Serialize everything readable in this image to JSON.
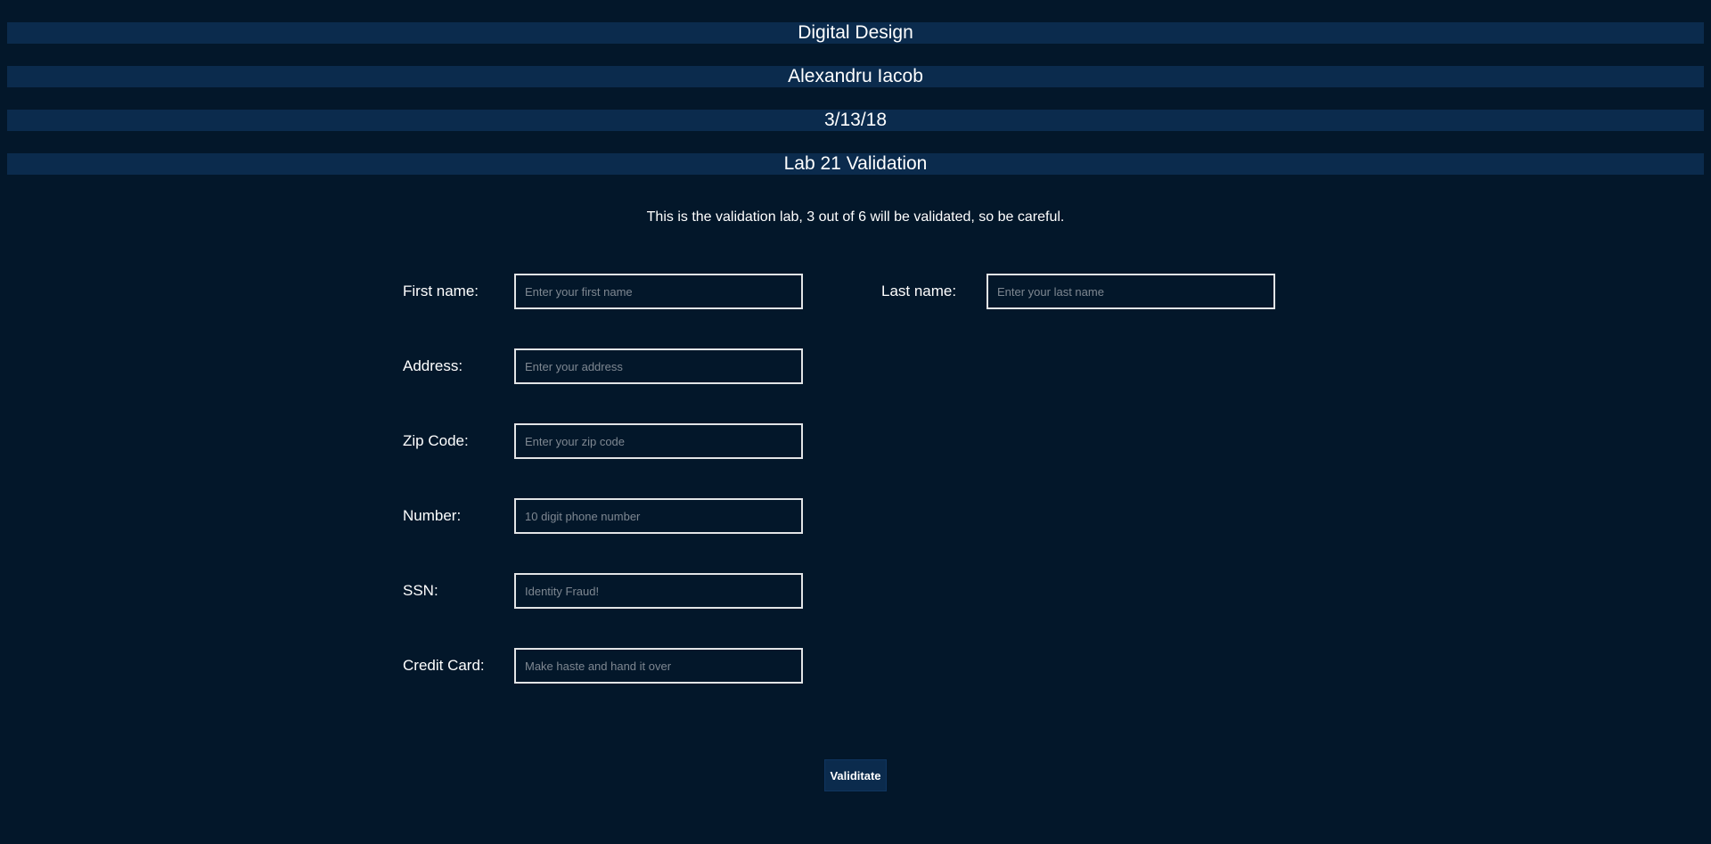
{
  "header": {
    "course": "Digital Design",
    "author": "Alexandru Iacob",
    "date": "3/13/18",
    "title": "Lab 21 Validation"
  },
  "intro": "This is the validation lab, 3 out of 6 will be validated, so be careful.",
  "form": {
    "first_name": {
      "label": "First name:",
      "placeholder": "Enter your first name",
      "value": ""
    },
    "last_name": {
      "label": "Last name:",
      "placeholder": "Enter your last name",
      "value": ""
    },
    "address": {
      "label": "Address:",
      "placeholder": "Enter your address",
      "value": ""
    },
    "zip": {
      "label": "Zip Code:",
      "placeholder": "Enter your zip code",
      "value": ""
    },
    "number": {
      "label": "Number:",
      "placeholder": "10 digit phone number",
      "value": ""
    },
    "ssn": {
      "label": "SSN:",
      "placeholder": "Identity Fraud!",
      "value": ""
    },
    "credit_card": {
      "label": "Credit Card:",
      "placeholder": "Make haste and hand it over",
      "value": ""
    },
    "submit_label": "Validitate"
  },
  "colors": {
    "background": "#03172a",
    "banner": "#0b2b4d",
    "text": "#ffffff",
    "input_border": "#e2e4e6",
    "placeholder": "#7e8791"
  }
}
